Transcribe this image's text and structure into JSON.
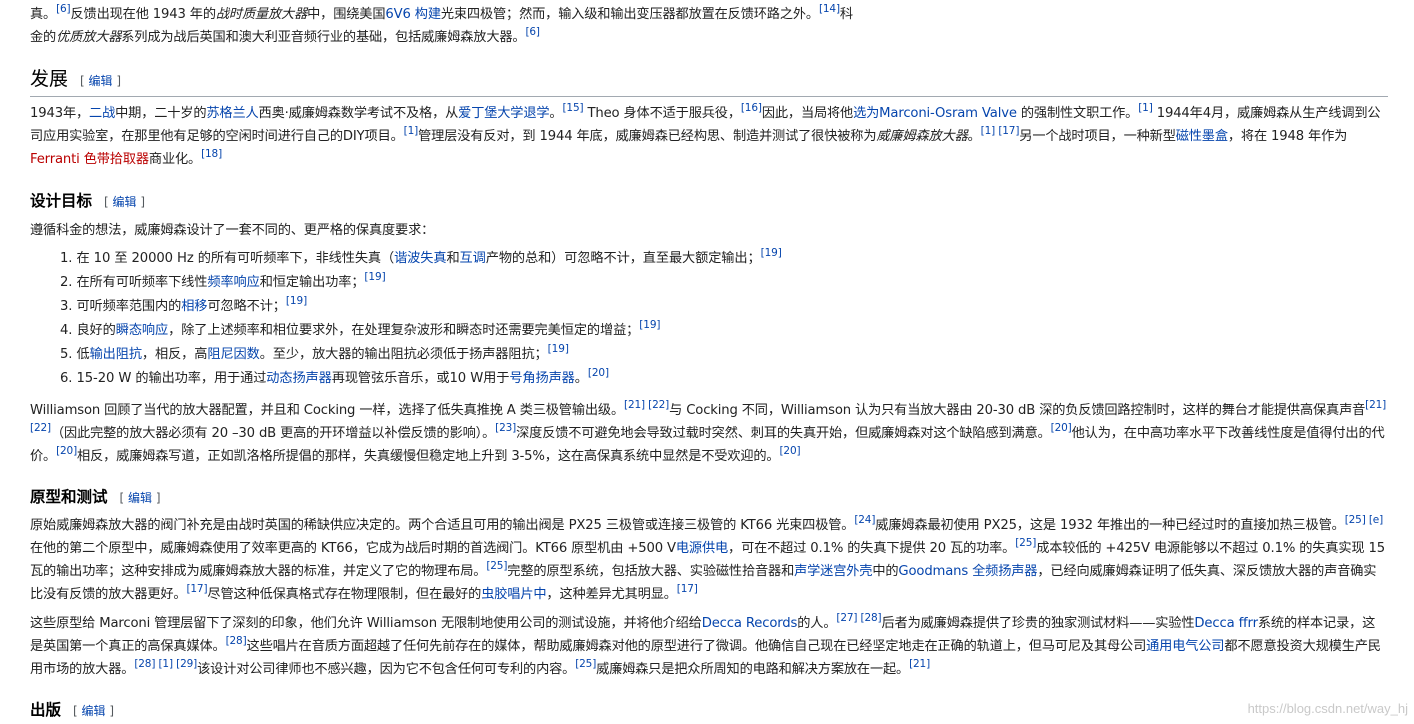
{
  "intro": {
    "l1_a": "真。",
    "l1_r1": "[6]",
    "l1_b": "反馈出现在他 1943 年的",
    "l1_i": "战时质量放大器",
    "l1_c": "中，围绕美国",
    "l1_link1": "6V6",
    "l1_link2": "构建",
    "l1_d": "光束四极管；然而，输入级和输出变压器都放置在反馈环路之外。",
    "l1_r2": "[14]",
    "l1_e": "科",
    "l2_a": "金的",
    "l2_i": "优质放大器",
    "l2_b": "系列成为战后英国和澳大利亚音频行业的基础，包括威廉姆森放大器。",
    "l2_r": "[6]"
  },
  "edit_label": "编辑",
  "section_dev": {
    "heading": "发展",
    "t1": "1943年，",
    "link_ww2": "二战",
    "t2": "中期，二十岁的",
    "link_scot": "苏格兰人",
    "t3": "西奥·威廉姆森数学考试不及格，从",
    "link_edin": "爱丁堡大学退学",
    "t4": "。",
    "r1": "[15]",
    "t5": " Theo 身体不适于服兵役，",
    "r2": "[16]",
    "t6": "因此，当局将他",
    "link_selected": "选为",
    "link_mov": "Marconi-Osram Valve",
    "t7": " 的强制性文职工作。",
    "r3": "[1]",
    "t8": " 1944年4月，威廉姆森从生产线调到公司应用实验室，在那里他有足够的空闲时间进行自己的DIY项目。",
    "r4": "[1]",
    "t9": "管理层没有反对，到 1944 年底，威廉姆森已经构思、制造并测试了很快被称为",
    "i1": "威廉姆森放大器",
    "t10": "。",
    "r5": "[1]",
    "r6": "[17]",
    "t11": "另一个战时项目，一种新型",
    "link_mag": "磁性墨盒",
    "t12": "，将在 1948 年作为",
    "link_ferranti": "Ferranti",
    "link_pickup": "色带拾取器",
    "t13": "商业化。",
    "r7": "[18]"
  },
  "section_goals": {
    "heading": "设计目标",
    "intro": "遵循科金的想法，威廉姆森设计了一套不同的、更严格的保真度要求：",
    "li1_a": "1. 在 10 至 20000 Hz 的所有可听频率下，非线性失真（",
    "li1_link1": "谐波失真",
    "li1_b": "和",
    "li1_link2": "互调",
    "li1_c": "产物的总和）可忽略不计，直至最大额定输出；",
    "li1_r": "[19]",
    "li2_a": "2. 在所有可听频率下线性",
    "li2_link": "频率响应",
    "li2_b": "和恒定输出功率；",
    "li2_r": "[19]",
    "li3_a": "3. 可听频率范围内的",
    "li3_link": "相移",
    "li3_b": "可忽略不计；",
    "li3_r": "[19]",
    "li4_a": "4. 良好的",
    "li4_link": "瞬态响应",
    "li4_b": "，除了上述频率和相位要求外，在处理复杂波形和瞬态时还需要完美恒定的增益；",
    "li4_r": "[19]",
    "li5_a": "5. 低",
    "li5_link1": "输出阻抗",
    "li5_b": "，相反，高",
    "li5_link2": "阻尼因数",
    "li5_c": "。至少，放大器的输出阻抗必须低于扬声器阻抗；",
    "li5_r": "[19]",
    "li6_a": "6. 15-20  W 的输出功率，用于通过",
    "li6_link1": "动态扬声器",
    "li6_b": "再现管弦乐音乐，或10 W用于",
    "li6_link2": "号角扬声器",
    "li6_c": "。",
    "li6_r": "[20]",
    "p_a": "Williamson 回顾了当代的放大器配置，并且和 Cocking 一样，选择了低失真推挽 A 类三极管输出级。",
    "p_r1": "[21]",
    "p_r2": "[22]",
    "p_b": "与 Cocking 不同，Williamson 认为只有当放大器由 20-30  dB 深的负反馈回路控制时，这样的舞台才能提供高保真声音",
    "p_r3": "[21]",
    "p_r4": "[22]",
    "p_c": "（因此完整的放大器必须有 20 –30  dB 更高的开环增益以补偿反馈的影响）。",
    "p_r5": "[23]",
    "p_d": "深度反馈不可避免地会导致过载时突然、刺耳的失真开始，但威廉姆森对这个缺陷感到满意。",
    "p_r6": "[20]",
    "p_e": "他认为，在中高功率水平下改善线性度是值得付出的代价。",
    "p_r7": "[20]",
    "p_f": "相反，威廉姆森写道，正如凯洛格所提倡的那样，失真缓慢但稳定地上升到 3-5%，这在高保真系统中显然是不受欢迎的。",
    "p_r8": "[20]"
  },
  "section_proto": {
    "heading": "原型和测试",
    "a1": "原始威廉姆森放大器的阀门补充是由战时英国的稀缺供应决定的。两个合适且可用的输出阀是 PX25 三极管或连接三极管的 KT66 光束四极管。",
    "r1": "[24]",
    "a2": "威廉姆森最初使用 PX25，这是 1932 年推出的一种已经过时的直接加热三极管。",
    "r2": "[25]",
    "r3": "[e]",
    "a3": "在他的第二个原型中，威廉姆森使用了效率更高的 KT66，它成为战后时期的首选阀门。KT66 原型机由 +500 V",
    "link_psu": "电源供电",
    "a4": "，可在不超过 0.1% 的失真下提供 20 瓦的功率。",
    "r4": "[25]",
    "a5": "成本较低的 +425V 电源能够以不超过 0.1% 的失真实现 15 瓦的输出功率；这种安排成为威廉姆森放大器的标准，并定义了它的物理布局。",
    "r5": "[25]",
    "a6": "完整的原型系统，包括放大器、实验磁性拾音器和",
    "link_maze": "声学迷宫外壳",
    "a7": "中的",
    "link_goodmans": "Goodmans 全频扬声器",
    "a8": "，已经向威廉姆森证明了低失真、深反馈放大器的声音确实比没有反馈的放大器更好。",
    "r6": "[17]",
    "a9": "尽管这种低保真格式存在物理限制，但在最好的",
    "link_shellac": "虫胶唱片中",
    "a10": "，这种差异尤其明显。",
    "r7": "[17]",
    "b1": "这些原型给 Marconi 管理层留下了深刻的印象，他们允许 Williamson 无限制地使用公司的测试设施，并将他介绍给",
    "link_decca": "Decca Records",
    "b2": "的人。",
    "r8": "[27]",
    "r9": "[28]",
    "b3": "后者为威廉姆森提供了珍贵的独家测试材料——实验性",
    "link_ffrr": "Decca ffrr",
    "b4": "系统的样本记录，这是英国第一个真正的高保真媒体。",
    "r10": "[28]",
    "b5": "这些唱片在音质方面超越了任何先前存在的媒体，帮助威廉姆森对他的原型进行了微调。他确信自己现在已经坚定地走在正确的轨道上，但马可尼及其母公司",
    "link_gec": "通用电气公司",
    "b6": "都不愿意投资大规模生产民用市场的放大器。",
    "r11": "[28]",
    "r12": "[1]",
    "r13": "[29]",
    "b7": "该设计对公司律师也不感兴趣，因为它不包含任何可专利的内容。",
    "r14": "[25]",
    "b8": "威廉姆森只是把众所周知的电路和解决方案放在一起。",
    "r15": "[21]"
  },
  "section_pub": {
    "heading": "出版"
  },
  "watermark": "https://blog.csdn.net/way_hj"
}
